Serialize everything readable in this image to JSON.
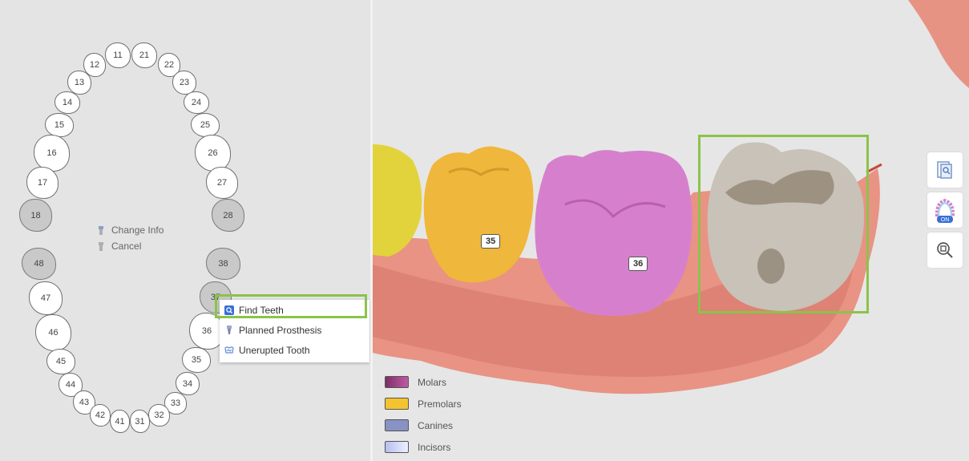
{
  "tooth_chart": {
    "upper": [
      "11",
      "21",
      "12",
      "22",
      "13",
      "23",
      "14",
      "24",
      "15",
      "25",
      "16",
      "26",
      "17",
      "27",
      "18",
      "28"
    ],
    "lower": [
      "48",
      "38",
      "37",
      "47",
      "36",
      "46",
      "35",
      "45",
      "34",
      "44",
      "33",
      "43",
      "32",
      "42",
      "41",
      "31"
    ],
    "missing": [
      "18",
      "28",
      "48",
      "38",
      "37"
    ]
  },
  "context_small": {
    "change_info": "Change Info",
    "cancel": "Cancel"
  },
  "popup_menu": {
    "find_teeth": "Find Teeth",
    "planned_prosthesis": "Planned Prosthesis",
    "unerupted_tooth": "Unerupted Tooth"
  },
  "scan_labels": {
    "t35": "35",
    "t36": "36"
  },
  "legend": [
    {
      "label": "Molars",
      "color": "#a0427f"
    },
    {
      "label": "Premolars",
      "color": "#f4c430"
    },
    {
      "label": "Canines",
      "color": "#8892c4"
    },
    {
      "label": "Incisors",
      "color": "#c5cdf0"
    }
  ],
  "colors": {
    "highlight": "#8bc34a",
    "gum": "#e38b7f",
    "molar": "#d77fce",
    "premolar": "#f0b73c",
    "canine_yellow": "#e0cf3a"
  },
  "toolbar": {
    "icons": [
      "document-search-icon",
      "arch-on-icon",
      "zoom-fit-icon"
    ],
    "arch_toggle": "ON"
  }
}
